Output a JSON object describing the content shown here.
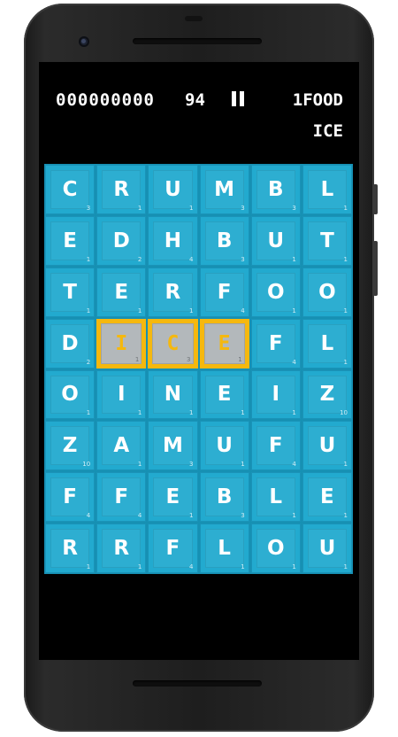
{
  "hud": {
    "score": "000000000",
    "timer": "94",
    "target": "1FOOD",
    "current_word": "ICE"
  },
  "grid": {
    "rows": [
      [
        {
          "letter": "C",
          "points": "3"
        },
        {
          "letter": "R",
          "points": "1"
        },
        {
          "letter": "U",
          "points": "1"
        },
        {
          "letter": "M",
          "points": "3"
        },
        {
          "letter": "B",
          "points": "3"
        },
        {
          "letter": "L",
          "points": "1"
        }
      ],
      [
        {
          "letter": "E",
          "points": "1"
        },
        {
          "letter": "D",
          "points": "2"
        },
        {
          "letter": "H",
          "points": "4"
        },
        {
          "letter": "B",
          "points": "3"
        },
        {
          "letter": "U",
          "points": "1"
        },
        {
          "letter": "T",
          "points": "1"
        }
      ],
      [
        {
          "letter": "T",
          "points": "1"
        },
        {
          "letter": "E",
          "points": "1"
        },
        {
          "letter": "R",
          "points": "1"
        },
        {
          "letter": "F",
          "points": "4"
        },
        {
          "letter": "O",
          "points": "1"
        },
        {
          "letter": "O",
          "points": "1"
        }
      ],
      [
        {
          "letter": "D",
          "points": "2"
        },
        {
          "letter": "I",
          "points": "1",
          "selected": true
        },
        {
          "letter": "C",
          "points": "3",
          "selected": true
        },
        {
          "letter": "E",
          "points": "1",
          "selected": true
        },
        {
          "letter": "F",
          "points": "4"
        },
        {
          "letter": "L",
          "points": "1"
        }
      ],
      [
        {
          "letter": "O",
          "points": "1"
        },
        {
          "letter": "I",
          "points": "1"
        },
        {
          "letter": "N",
          "points": "1"
        },
        {
          "letter": "E",
          "points": "1"
        },
        {
          "letter": "I",
          "points": "1"
        },
        {
          "letter": "Z",
          "points": "10"
        }
      ],
      [
        {
          "letter": "Z",
          "points": "10"
        },
        {
          "letter": "A",
          "points": "1"
        },
        {
          "letter": "M",
          "points": "3"
        },
        {
          "letter": "U",
          "points": "1"
        },
        {
          "letter": "F",
          "points": "4"
        },
        {
          "letter": "U",
          "points": "1"
        }
      ],
      [
        {
          "letter": "F",
          "points": "4"
        },
        {
          "letter": "F",
          "points": "4"
        },
        {
          "letter": "E",
          "points": "1"
        },
        {
          "letter": "B",
          "points": "3"
        },
        {
          "letter": "L",
          "points": "1"
        },
        {
          "letter": "E",
          "points": "1"
        }
      ],
      [
        {
          "letter": "R",
          "points": "1"
        },
        {
          "letter": "R",
          "points": "1"
        },
        {
          "letter": "F",
          "points": "4"
        },
        {
          "letter": "L",
          "points": "1"
        },
        {
          "letter": "O",
          "points": "1"
        },
        {
          "letter": "U",
          "points": "1"
        }
      ]
    ]
  },
  "colors": {
    "tile": "#22aacf",
    "grid_background": "#1690b3",
    "selection": "#f5b80e",
    "selected_tile": "#b3b8bb"
  },
  "icons": {
    "pause": "pause-icon"
  }
}
